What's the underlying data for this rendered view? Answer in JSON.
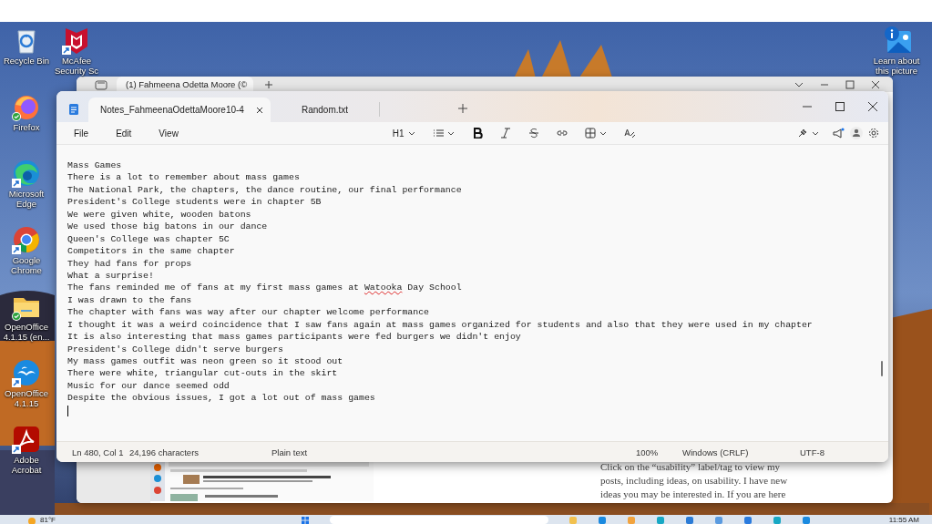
{
  "desktop_icons": [
    {
      "label": "Recycle Bin",
      "kind": "recycle"
    },
    {
      "label": "Firefox",
      "kind": "firefox"
    },
    {
      "label": "Microsoft Edge",
      "kind": "edge"
    },
    {
      "label": "Google Chrome",
      "kind": "chrome"
    },
    {
      "label": "OpenOffice 4.1.15 (en...",
      "kind": "folder"
    },
    {
      "label": "OpenOffice 4.1.15",
      "kind": "openoffice"
    },
    {
      "label": "Adobe Acrobat",
      "kind": "acrobat"
    }
  ],
  "second_column_icons": [
    {
      "label": "McAfee Security Sc",
      "kind": "mcafee"
    }
  ],
  "learn_icon": {
    "label": "Learn about this picture",
    "kind": "learn"
  },
  "back_window": {
    "tab": "(1) Fahmeena Odetta Moore (©",
    "blog_lines": [
      "Click on the “usability” label/tag to view my",
      "posts, including ideas, on usability. I have new",
      "ideas you may be interested in. If you are here"
    ]
  },
  "notepad": {
    "tabs": [
      {
        "label": "Notes_FahmeenaOdettaMoore10-4",
        "selected": true
      },
      {
        "label": "Random.txt",
        "selected": false
      }
    ],
    "menu": [
      "File",
      "Edit",
      "View"
    ],
    "heading_button": "H1",
    "lines": [
      "Mass Games",
      "There is a lot to remember about mass games",
      "The National Park, the chapters, the dance routine, our final performance",
      "President's College students were in chapter 5B",
      "We were given white, wooden batons",
      "We used those big batons in our dance",
      "Queen's College was chapter 5C",
      "Competitors in the same chapter",
      "They had fans for props",
      "What a surprise!",
      [
        {
          "text": "The fans reminded me of fans at my first mass games at ",
          "misspelled": false
        },
        {
          "text": "Watooka",
          "misspelled": true
        },
        {
          "text": " Day School",
          "misspelled": false
        }
      ],
      "I was drawn to the fans",
      "The chapter with fans was way after our chapter welcome performance",
      "I thought it was a weird coincidence that I saw fans again at mass games organized for students and also that they were used in my chapter",
      "It is also interesting that mass games participants were fed burgers we didn't enjoy",
      "President's College didn't serve burgers",
      "My mass games outfit was neon green so it stood out",
      "There were white, triangular cut-outs in the skirt",
      "Music for our dance seemed odd",
      "Despite the obvious issues, I got a lot out of mass games"
    ],
    "status": {
      "position": "Ln 480, Col 1",
      "characters": "24,196 characters",
      "format": "Plain text",
      "zoom": "100%",
      "line_endings": "Windows (CRLF)",
      "encoding": "UTF-8"
    }
  },
  "taskbar": {
    "weather": "81°F",
    "time": "11:55 AM"
  }
}
